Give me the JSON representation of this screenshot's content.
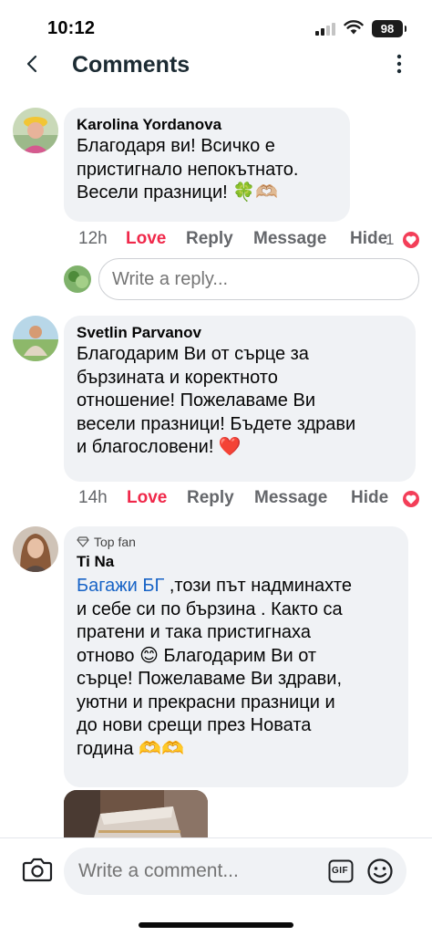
{
  "status_bar": {
    "time": "10:12",
    "battery": "98"
  },
  "header": {
    "title": "Comments"
  },
  "comments": [
    {
      "author": "Karolina Yordanova",
      "text": "Благодаря ви! Всичко е\nпристигнало непокътнато.\nВесели празници! 🍀🫶🏼",
      "time": "12h",
      "love": "Love",
      "reply": "Reply",
      "message": "Message",
      "hide": "Hide",
      "reaction_count": "1"
    },
    {
      "author": "Svetlin Parvanov",
      "text": "Благодарим Ви от сърце за\nбързината и коректното\nотношение! Пожелаваме Ви\nвесели празници! Бъдете здрави\nи благословени! ❤️",
      "time": "14h",
      "love": "Love",
      "reply": "Reply",
      "message": "Message",
      "hide": "Hide"
    },
    {
      "badge": "Top fan",
      "author": "Ti Na",
      "mention": "Багажи БГ",
      "text": " ,този път надминахте\nи себе си по бързина . Както са\nпратени и така пристигнаха\nотново 😊 Благодарим Ви от\nсърце! Пожелаваме Ви здрави,\nуютни и прекрасни празници и\nдо нови срещи през Новата\nгодина 🫶🫶"
    }
  ],
  "reply_box": {
    "placeholder": "Write a reply..."
  },
  "composer": {
    "placeholder": "Write a comment...",
    "gif_label": "GIF"
  },
  "colors": {
    "love": "#f0284a",
    "mention": "#1763c6",
    "bubble": "#f0f2f5"
  },
  "icons": [
    "back-icon",
    "more-icon",
    "camera-icon",
    "gif-icon",
    "emoji-icon",
    "heart-reaction-icon",
    "diamond-icon"
  ]
}
